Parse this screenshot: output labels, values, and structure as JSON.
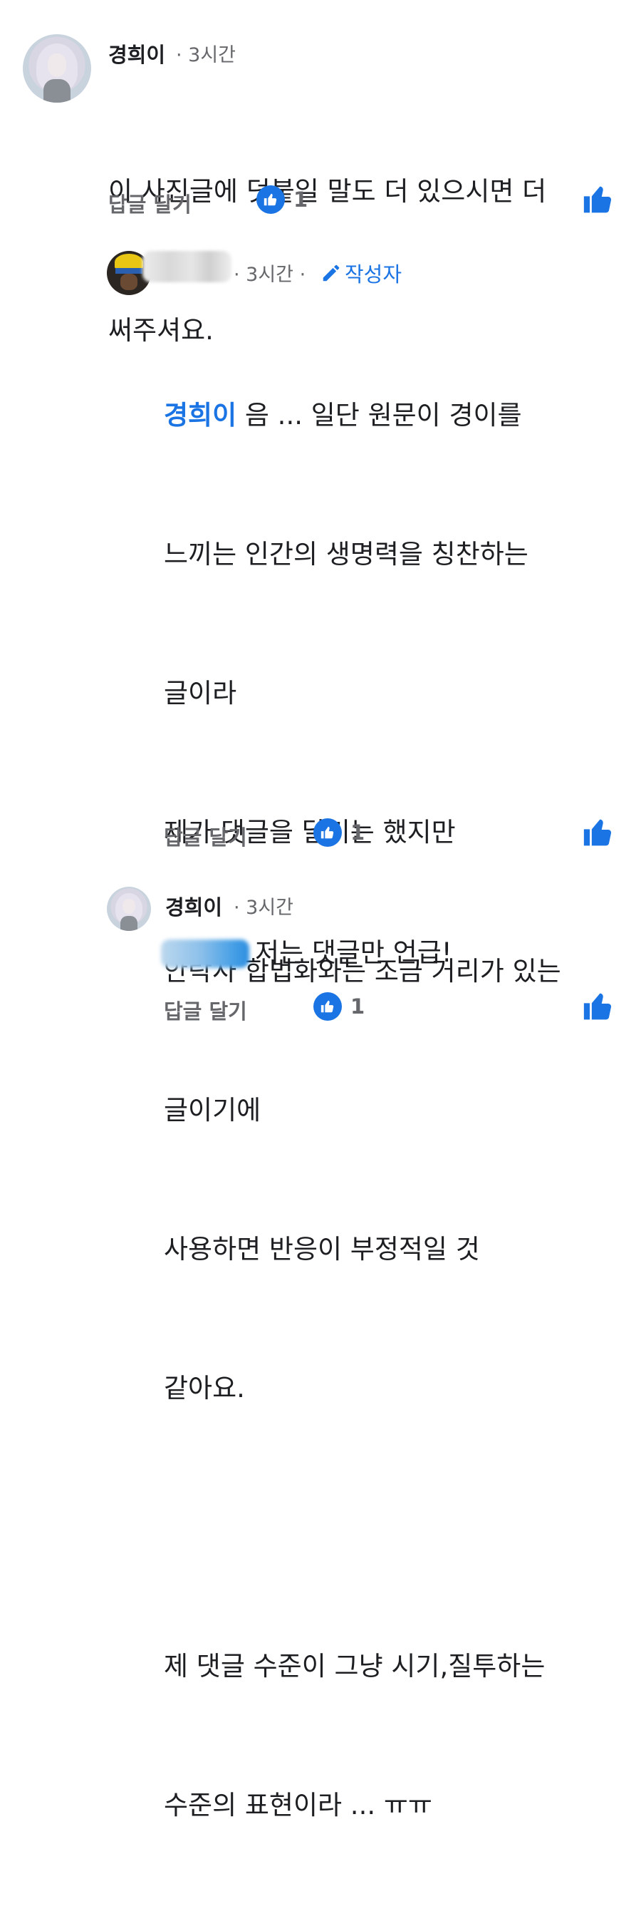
{
  "comments": [
    {
      "name": "경희이",
      "time": "· 3시간",
      "lines": [
        "이 사진글에 덧붙일 말도 더 있으시면 더",
        "써주셔요."
      ],
      "reply_label": "답글 달기",
      "like_count": "1"
    },
    {
      "time": "· 3시간 ·",
      "author_badge": "작성자",
      "mention": "경희이",
      "first_line_rest": " 음 ... 일단 원문이 경이를",
      "lines": [
        "느끼는 인간의 생명력을 칭찬하는",
        "글이라",
        "제가 댓글을 달기는 했지만",
        "안락사 합법화와는 조금 거리가 있는",
        "글이기에",
        "사용하면 반응이 부정적일 것",
        "같아요.",
        "",
        "제 댓글 수준이 그냥 시기,질투하는",
        "수준의 표현이라 ... ㅠㅠ"
      ],
      "reply_label": "답글 달기",
      "like_count": "1"
    },
    {
      "name": "경희이",
      "time": "· 3시간",
      "text": "저는 댓글만 언급!",
      "reply_label": "답글 달기",
      "like_count": "1"
    }
  ],
  "colors": {
    "accent": "#1b74e4",
    "meta": "#65676b",
    "text": "#1c1e21"
  },
  "icons": {
    "like": "thumbs-up-icon",
    "pencil": "pencil-icon"
  }
}
